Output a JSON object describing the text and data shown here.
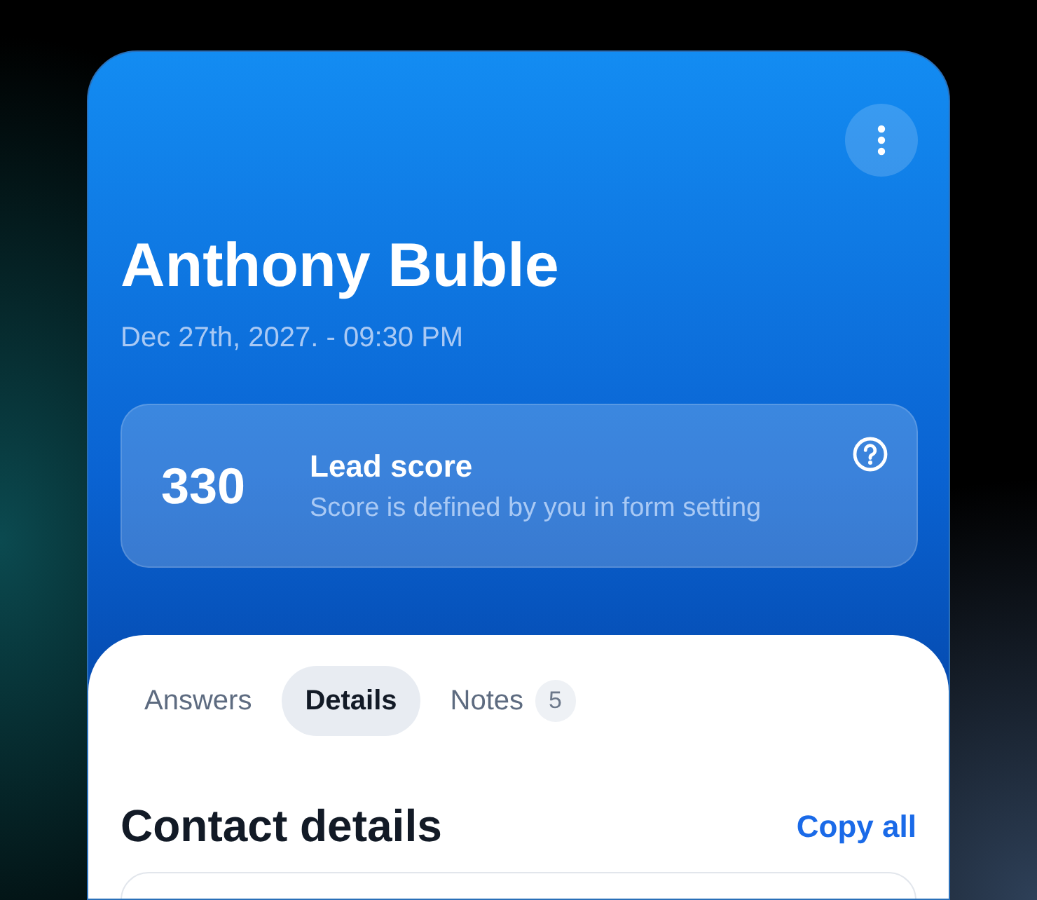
{
  "contact": {
    "name": "Anthony Buble",
    "date": "Dec 27th, 2027. - 09:30 PM"
  },
  "lead_score": {
    "value": "330",
    "title": "Lead score",
    "description": "Score is defined by you in form setting"
  },
  "tabs": [
    {
      "label": "Answers",
      "selected": false
    },
    {
      "label": "Details",
      "selected": true
    },
    {
      "label": "Notes",
      "selected": false,
      "badge": "5"
    }
  ],
  "section": {
    "title": "Contact details",
    "action": "Copy all"
  }
}
